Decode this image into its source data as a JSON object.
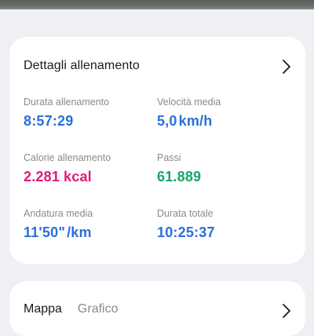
{
  "details": {
    "title": "Dettagli allenamento",
    "metrics": [
      {
        "label": "Durata allenamento",
        "value": "8:57:29",
        "unit": "",
        "color": "#2a6fdb"
      },
      {
        "label": "Velocità media",
        "value": "5,0",
        "unit": "km/h",
        "color": "#2a6fdb"
      },
      {
        "label": "Calorie allenamento",
        "value": "2.281",
        "unit": "kcal",
        "color": "#e3197a"
      },
      {
        "label": "Passi",
        "value": "61.889",
        "unit": "",
        "color": "#1aa56a"
      },
      {
        "label": "Andatura media",
        "value": "11'50\"",
        "unit": "/km",
        "color": "#2a6fdb"
      },
      {
        "label": "Durata totale",
        "value": "10:25:37",
        "unit": "",
        "color": "#2a6fdb"
      }
    ]
  },
  "map_card": {
    "tabs": [
      "Mappa",
      "Grafico"
    ]
  },
  "icons": {
    "details_chevron": "chevron-right-icon",
    "map_chevron": "chevron-right-icon"
  }
}
